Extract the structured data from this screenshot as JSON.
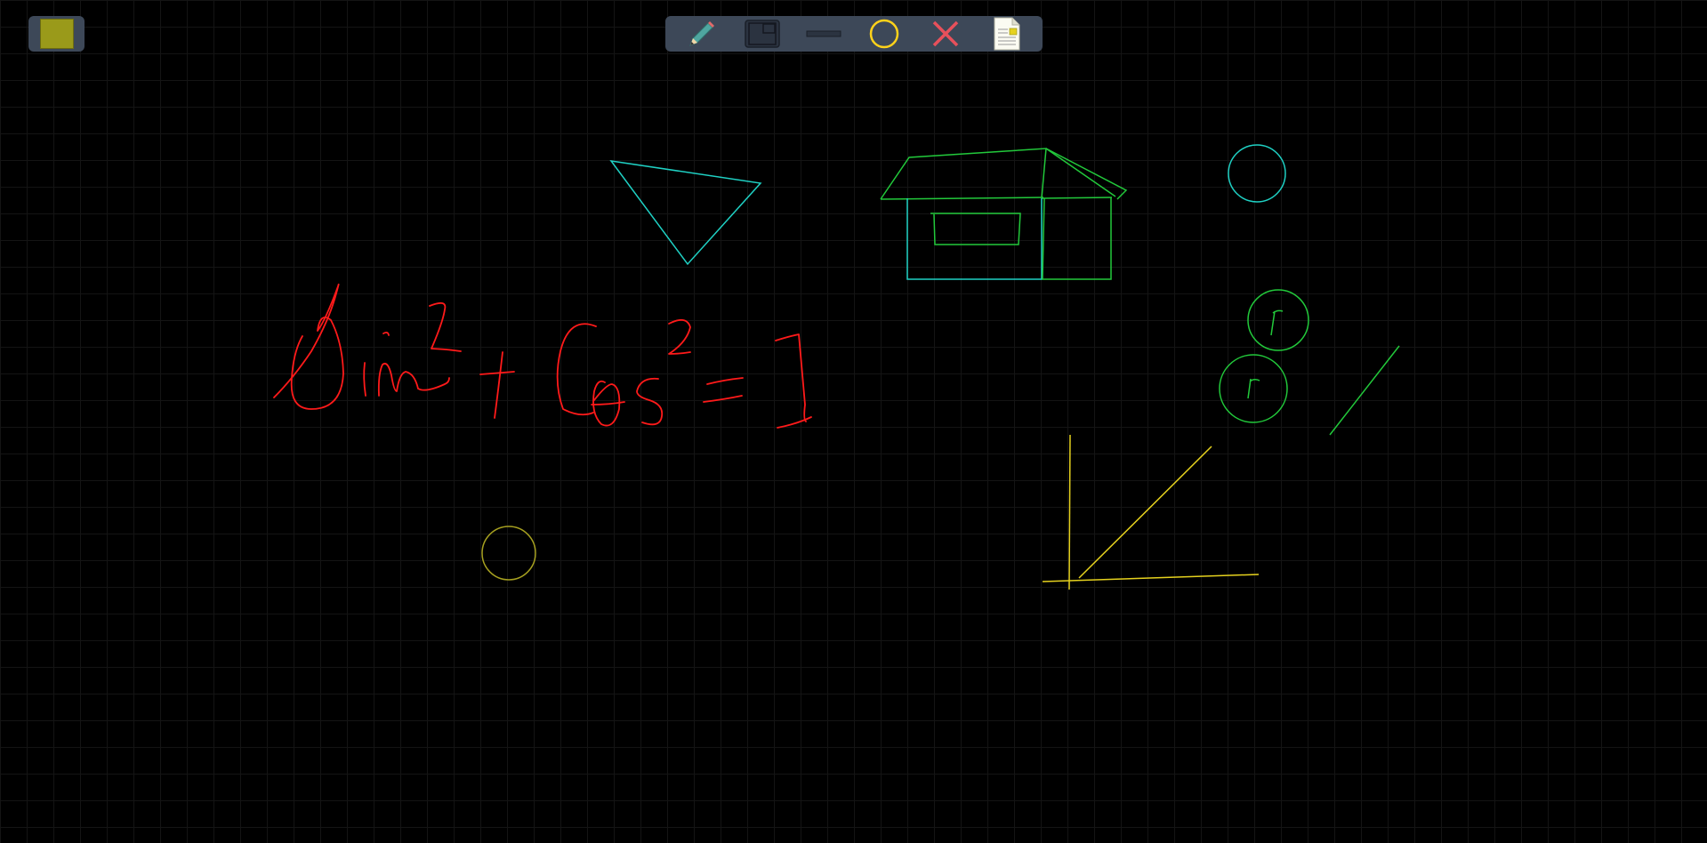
{
  "palette": {
    "selected_color": "#9a9a1a",
    "label": "color-swatch"
  },
  "toolbar": {
    "tools": [
      {
        "name": "pencil",
        "icon": "pencil-icon"
      },
      {
        "name": "rectangle",
        "icon": "rectangle-icon"
      },
      {
        "name": "line",
        "icon": "line-icon"
      },
      {
        "name": "circle",
        "icon": "circle-icon",
        "color": "#ffd21a"
      },
      {
        "name": "clear",
        "icon": "close-icon",
        "color": "#e8505b"
      },
      {
        "name": "document",
        "icon": "document-icon"
      }
    ]
  },
  "drawing": {
    "colors": {
      "red": "#ff1a1a",
      "cyan": "#1fd1c4",
      "green": "#22c93b",
      "yellow": "#e6d21e",
      "olive": "#a6a020"
    }
  }
}
